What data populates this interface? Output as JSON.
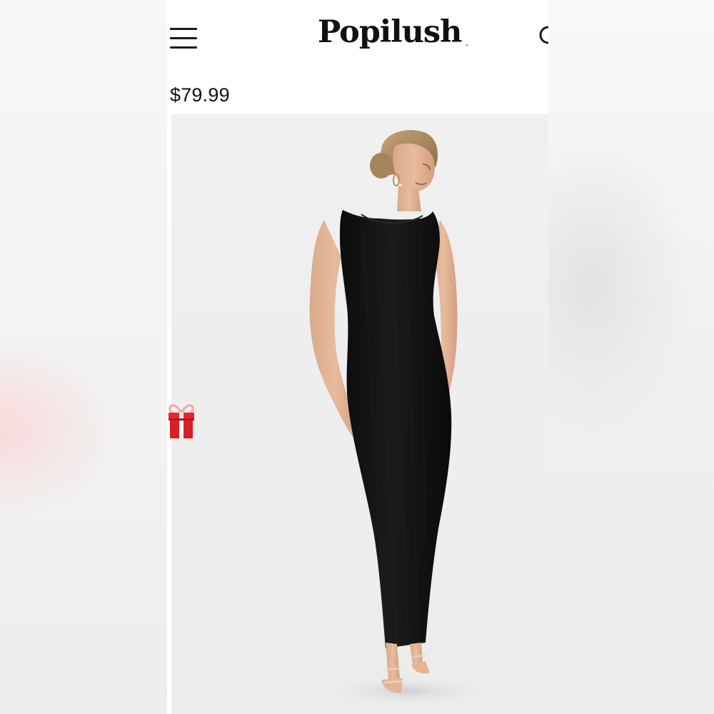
{
  "brand": {
    "logo_text": "Popilush",
    "trademark": "™"
  },
  "header": {
    "menu_icon": "hamburger-menu-icon",
    "search_icon": "search-icon"
  },
  "product": {
    "price": "$79.99",
    "image": "black sleeveless ribbed maxi dress"
  },
  "floating": {
    "gift_icon": "gift-icon"
  },
  "colors": {
    "gift_red": "#e8252b",
    "dress": "#111111",
    "background": "#efeff0"
  }
}
